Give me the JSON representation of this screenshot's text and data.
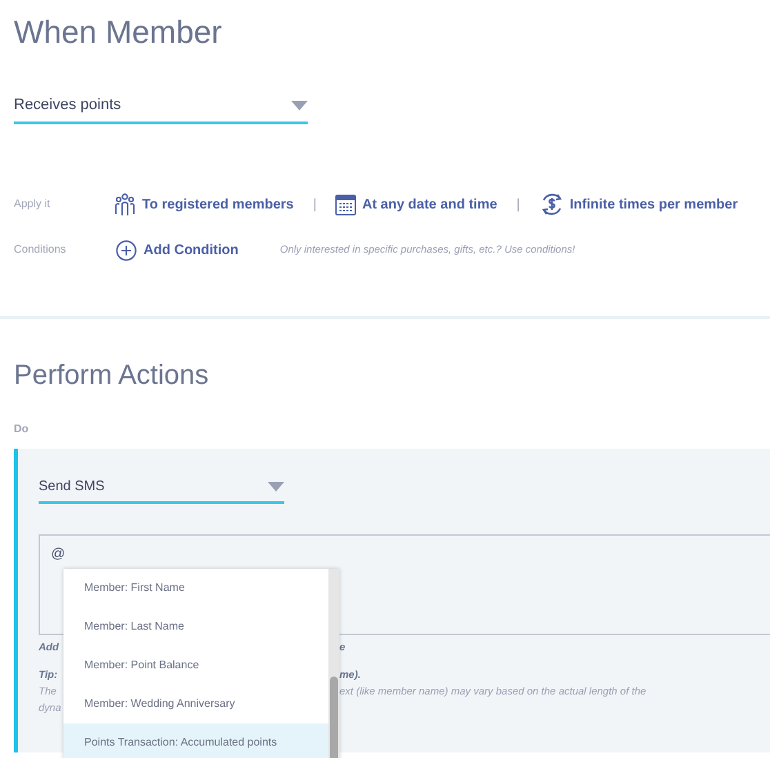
{
  "trigger": {
    "title": "When Member",
    "select": "Receives points"
  },
  "apply": {
    "label": "Apply it",
    "separator": "|",
    "options": [
      {
        "kind": "members",
        "text": "To registered members"
      },
      {
        "kind": "calendar",
        "text": "At any date and time"
      },
      {
        "kind": "repeat",
        "text": "Infinite times per member"
      }
    ]
  },
  "conditions": {
    "label": "Conditions",
    "button": "Add Condition",
    "hint": "Only interested in specific purchases, gifts, etc.? Use conditions!"
  },
  "actions": {
    "title": "Perform Actions",
    "do_label": "Do",
    "select": "Send SMS",
    "message": "@",
    "hints": [
      {
        "kind": "strong",
        "left": "Add",
        "right": "e"
      },
      {
        "kind": "strong",
        "left": "Tip:",
        "right": "me)."
      },
      {
        "kind": "plain",
        "left": "The",
        "right": "ext (like member name) may vary based on the actual length of the"
      },
      {
        "kind": "plain",
        "left": "dyna"
      }
    ],
    "suggestions": [
      {
        "text": "Member: First Name",
        "selected": false
      },
      {
        "text": "Member: Last Name",
        "selected": false
      },
      {
        "text": "Member: Point Balance",
        "selected": false
      },
      {
        "text": "Member: Wedding Anniversary",
        "selected": false
      },
      {
        "text": "Points Transaction: Accumulated points",
        "selected": true
      }
    ]
  }
}
